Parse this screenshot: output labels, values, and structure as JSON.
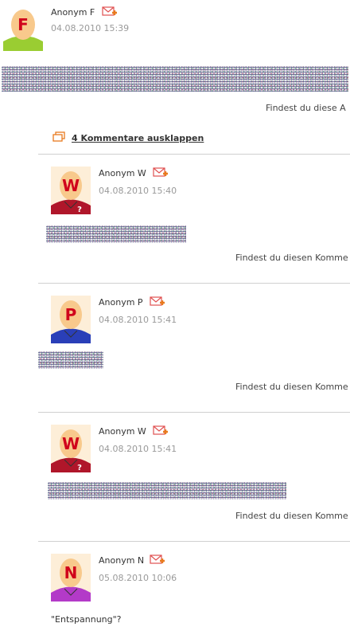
{
  "post": {
    "avatar_letter": "F",
    "author": "Anonym F",
    "date": "04.08.2010 15:39",
    "question": "Findest du diese A",
    "shirt_color": "#9acd32"
  },
  "comments_toggle": {
    "label": "4 Kommentare ausklappen"
  },
  "comments": [
    {
      "avatar_letter": "W",
      "author": "Anonym W",
      "date": "04.08.2010 15:40",
      "question": "Findest du diesen Komme",
      "shirt_color": "#b0162a"
    },
    {
      "avatar_letter": "P",
      "author": "Anonym P",
      "date": "04.08.2010 15:41",
      "question": "Findest du diesen Komme",
      "shirt_color": "#2a3fb8"
    },
    {
      "avatar_letter": "W",
      "author": "Anonym W",
      "date": "04.08.2010 15:41",
      "question": "Findest du diesen Komme",
      "shirt_color": "#b0162a"
    },
    {
      "avatar_letter": "N",
      "author": "Anonym N",
      "date": "05.08.2010 10:06",
      "text": "\"Entspannung\"?",
      "shirt_color": "#b33ac8"
    }
  ],
  "colors": {
    "accent_orange": "#e87a1e",
    "mail_icon": "#e05050",
    "face": "#f8c98c",
    "letter": "#d0021b"
  }
}
